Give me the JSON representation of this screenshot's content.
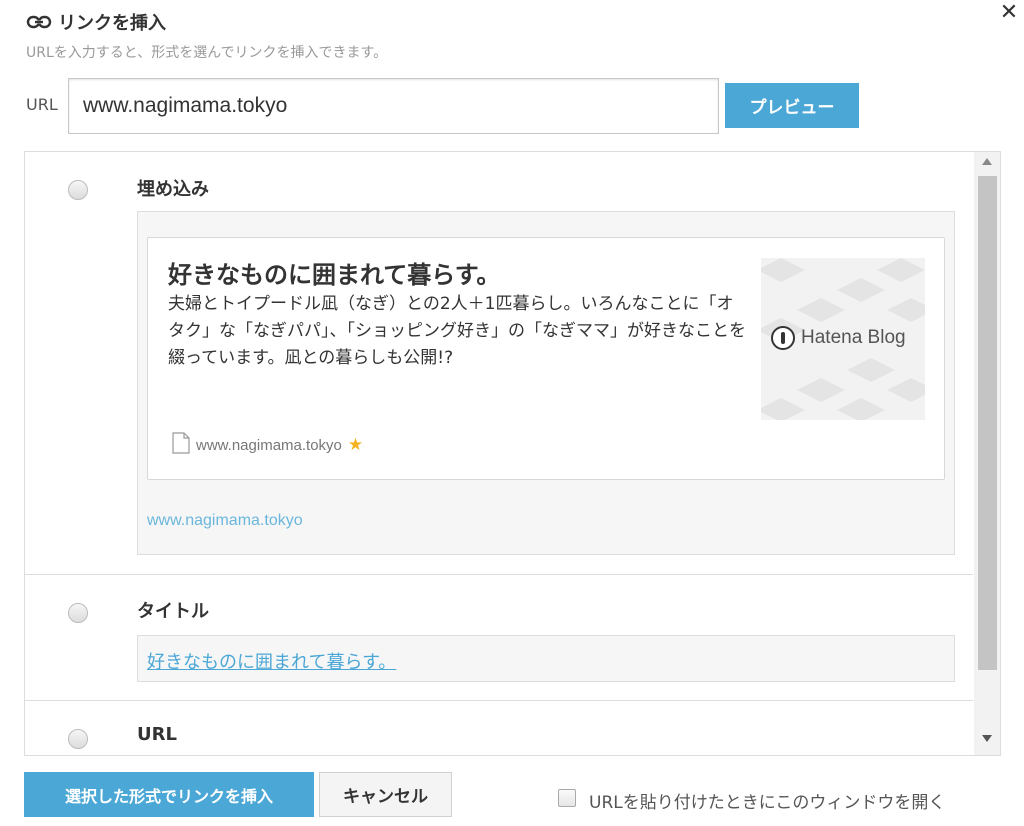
{
  "dialog": {
    "title": "リンクを挿入",
    "description": "URLを入力すると、形式を選んでリンクを挿入できます。",
    "close_label": "✕",
    "title_icon": "link-icon",
    "close_icon": "close-icon"
  },
  "url_row": {
    "label": "URL",
    "value": "www.nagimama.tokyo",
    "preview_label": "プレビュー"
  },
  "options": {
    "embed": {
      "label": "埋め込み",
      "card": {
        "title": "好きなものに囲まれて暮らす。",
        "description": "夫婦とトイプードル凪（なぎ）との2人＋1匹暮らし。いろんなことに「オタク」な「なぎパパ」、「ショッピング好き」の「なぎママ」が好きなことを綴っています。凪との暮らしも公開!?",
        "thumbnail_text": "Hatena Blog",
        "site": "www.nagimama.tokyo",
        "site_icon": "document-icon",
        "star": "★"
      },
      "link_text": "www.nagimama.tokyo"
    },
    "title": {
      "label": "タイトル",
      "link_text": "好きなものに囲まれて暮らす。"
    },
    "url": {
      "label": "URL"
    }
  },
  "footer": {
    "insert_label": "選択した形式でリンクを挿入",
    "cancel_label": "キャンセル",
    "auto_open_label": "URLを貼り付けたときにこのウィンドウを開く"
  },
  "colors": {
    "accent": "#4ba8d6",
    "link": "#6bb6dc",
    "star": "#f5b324"
  }
}
